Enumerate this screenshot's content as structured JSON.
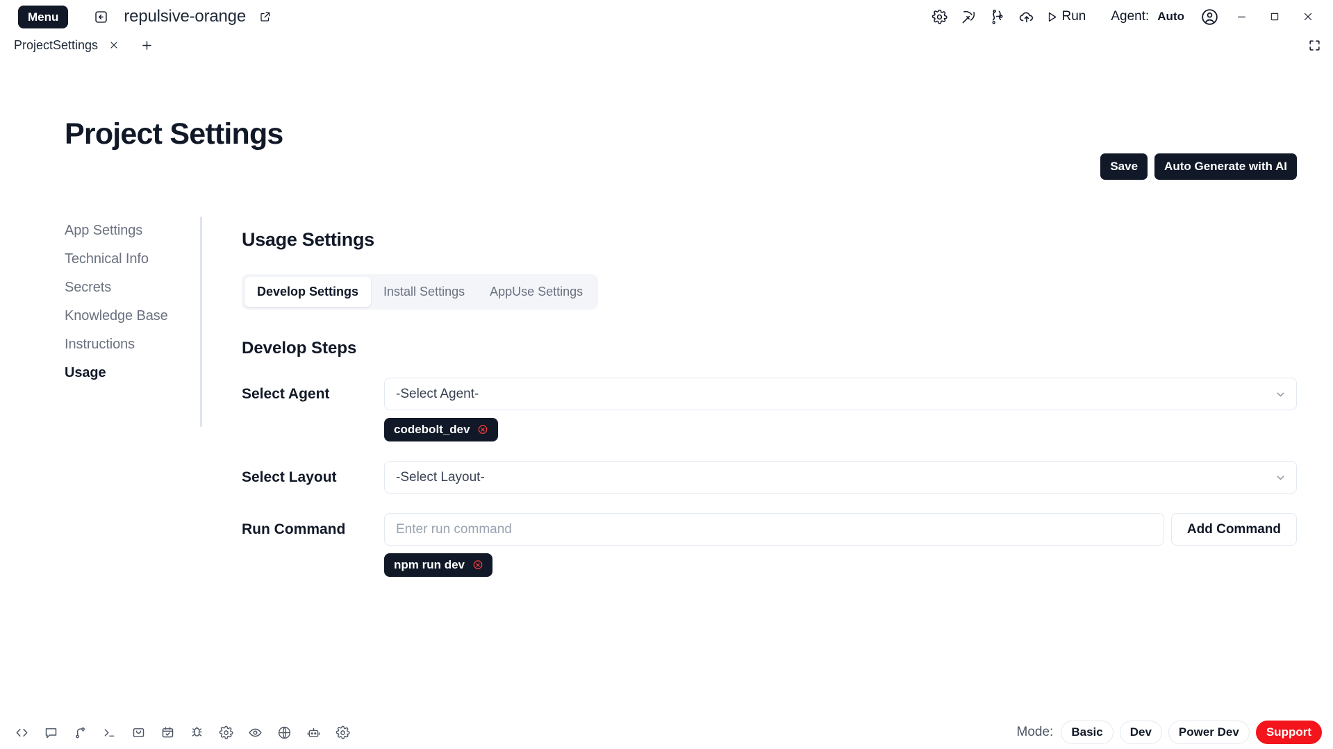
{
  "titlebar": {
    "menu_label": "Menu",
    "back_icon": "back-arrow-icon",
    "project_name": "repulsive-orange",
    "external_icon": "external-link-icon",
    "icons": [
      {
        "name": "gear-icon",
        "label": "Settings"
      },
      {
        "name": "pickaxe-icon",
        "label": "Build"
      },
      {
        "name": "git-branch-icon",
        "label": "Source Control"
      },
      {
        "name": "cloud-upload-icon",
        "label": "Deploy"
      }
    ],
    "run_label": "Run",
    "agent_label": "Agent:",
    "agent_value": "Auto",
    "account_icon": "account-circle-icon",
    "minimize_label": "–",
    "maximize_label": "□",
    "close_label": "✕"
  },
  "tabstrip": {
    "tabs": [
      {
        "label": "ProjectSettings",
        "active": true
      }
    ],
    "add_tab_label": "+",
    "expand_icon": "fullscreen-icon"
  },
  "page": {
    "title": "Project Settings",
    "actions": {
      "save_label": "Save",
      "auto_generate_label": "Auto Generate with AI"
    }
  },
  "sidebar": {
    "items": [
      {
        "label": "App Settings",
        "active": false
      },
      {
        "label": "Technical Info",
        "active": false
      },
      {
        "label": "Secrets",
        "active": false
      },
      {
        "label": "Knowledge Base",
        "active": false
      },
      {
        "label": "Instructions",
        "active": false
      },
      {
        "label": "Usage",
        "active": true
      }
    ]
  },
  "main": {
    "section_title": "Usage Settings",
    "tabs": [
      {
        "label": "Develop Settings",
        "active": true
      },
      {
        "label": "Install Settings",
        "active": false
      },
      {
        "label": "AppUse Settings",
        "active": false
      }
    ],
    "subsection_title": "Develop Steps",
    "select_agent": {
      "label": "Select Agent",
      "value": "-Select Agent-",
      "chevron_icon": "chevron-down-icon",
      "chips": [
        {
          "label": "codebolt_dev",
          "remove_icon": "remove-circle-icon"
        }
      ]
    },
    "select_layout": {
      "label": "Select Layout",
      "value": "-Select Layout-",
      "chevron_icon": "chevron-down-icon",
      "chips": []
    },
    "run_command": {
      "label": "Run Command",
      "placeholder": "Enter run command",
      "value": "",
      "add_button_label": "Add Command",
      "chips": [
        {
          "label": "npm run dev",
          "remove_icon": "remove-circle-icon"
        }
      ]
    }
  },
  "statusbar": {
    "icons": [
      {
        "name": "code-brackets-icon"
      },
      {
        "name": "chat-bubble-icon"
      },
      {
        "name": "git-branch-icon"
      },
      {
        "name": "terminal-icon"
      },
      {
        "name": "inbox-icon"
      },
      {
        "name": "calendar-check-icon"
      },
      {
        "name": "bug-icon"
      },
      {
        "name": "gear-icon"
      },
      {
        "name": "eye-icon"
      },
      {
        "name": "globe-icon"
      },
      {
        "name": "robot-icon"
      },
      {
        "name": "gear-advanced-icon"
      }
    ],
    "mode_label": "Mode:",
    "modes": [
      {
        "label": "Basic",
        "style": "plain"
      },
      {
        "label": "Dev",
        "style": "plain"
      },
      {
        "label": "Power Dev",
        "style": "plain"
      },
      {
        "label": "Support",
        "style": "support"
      }
    ]
  },
  "colors": {
    "dark": "#111827",
    "accent_red": "#f4141b",
    "muted": "#6b7280",
    "border": "#e3e9f1"
  }
}
